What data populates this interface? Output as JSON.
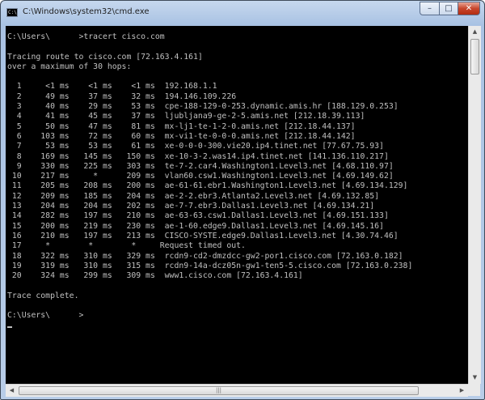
{
  "window": {
    "title": "C:\\Windows\\system32\\cmd.exe",
    "icon_label": "C:\\",
    "minimize_glyph": "–",
    "maximize_glyph": "□",
    "close_glyph": "✕"
  },
  "console": {
    "colors": {
      "background": "#000000",
      "text": "#c0c0c0"
    },
    "lines": [
      "C:\\Users\\      >tracert cisco.com",
      "",
      "Tracing route to cisco.com [72.163.4.161]",
      "over a maximum of 30 hops:",
      "",
      "  1     <1 ms    <1 ms    <1 ms  192.168.1.1",
      "  2     49 ms    37 ms    32 ms  194.146.109.226",
      "  3     40 ms    29 ms    53 ms  cpe-188-129-0-253.dynamic.amis.hr [188.129.0.253]",
      "  4     41 ms    45 ms    37 ms  ljubljana9-ge-2-5.amis.net [212.18.39.113]",
      "  5     50 ms    47 ms    81 ms  mx-lj1-te-1-2-0.amis.net [212.18.44.137]",
      "  6    103 ms    72 ms    60 ms  mx-vi1-te-0-0-0.amis.net [212.18.44.142]",
      "  7     53 ms    53 ms    61 ms  xe-0-0-0-300.vie20.ip4.tinet.net [77.67.75.93]",
      "  8    169 ms   145 ms   150 ms  xe-10-3-2.was14.ip4.tinet.net [141.136.110.217]",
      "  9    330 ms   225 ms   303 ms  te-7-2.car4.Washington1.Level3.net [4.68.110.97]",
      " 10    217 ms     *      209 ms  vlan60.csw1.Washington1.Level3.net [4.69.149.62]",
      " 11    205 ms   208 ms   200 ms  ae-61-61.ebr1.Washington1.Level3.net [4.69.134.129]",
      " 12    209 ms   185 ms   204 ms  ae-2-2.ebr3.Atlanta2.Level3.net [4.69.132.85]",
      " 13    204 ms   204 ms   202 ms  ae-7-7.ebr3.Dallas1.Level3.net [4.69.134.21]",
      " 14    282 ms   197 ms   210 ms  ae-63-63.csw1.Dallas1.Level3.net [4.69.151.133]",
      " 15    200 ms   219 ms   230 ms  ae-1-60.edge9.Dallas1.Level3.net [4.69.145.16]",
      " 16    210 ms   197 ms   213 ms  CISCO-SYSTE.edge9.Dallas1.Level3.net [4.30.74.46]",
      " 17     *        *        *     Request timed out.",
      " 18    322 ms   310 ms   329 ms  rcdn9-cd2-dmzdcc-gw2-por1.cisco.com [72.163.0.182]",
      " 19    319 ms   310 ms   315 ms  rcdn9-14a-dcz05n-gw1-ten5-5.cisco.com [72.163.0.238]",
      " 20    324 ms   299 ms   309 ms  www1.cisco.com [72.163.4.161]",
      "",
      "Trace complete.",
      "",
      "C:\\Users\\      >"
    ]
  },
  "scrollbars": {
    "up_glyph": "▲",
    "down_glyph": "▼",
    "left_glyph": "◀",
    "right_glyph": "▶",
    "thumb_grip": "|||"
  }
}
